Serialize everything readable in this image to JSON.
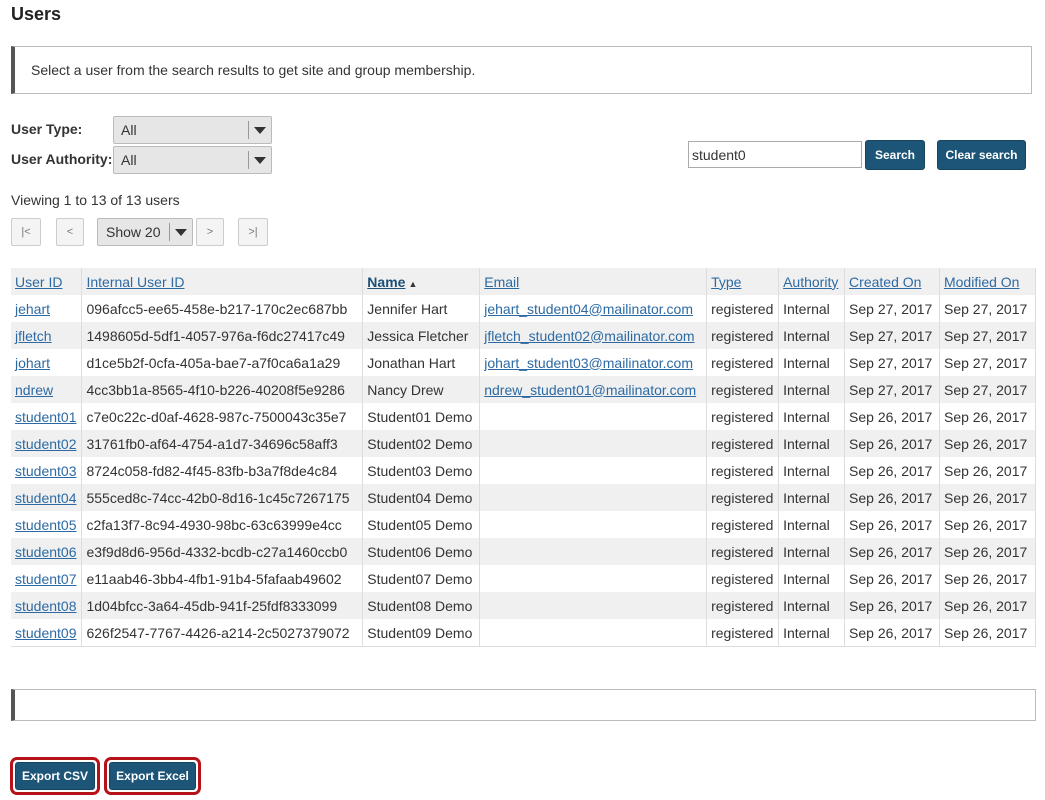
{
  "page": {
    "title": "Users"
  },
  "info": {
    "message": "Select a user from the search results to get site and group membership."
  },
  "filters": {
    "user_type_label": "User Type:",
    "user_type_value": "All",
    "user_authority_label": "User Authority:",
    "user_authority_value": "All"
  },
  "search": {
    "value": "student0",
    "search_label": "Search",
    "clear_label": "Clear search"
  },
  "pager": {
    "viewing_text": "Viewing 1 to 13 of 13 users",
    "first": "|<",
    "prev": "<",
    "show": "Show 20",
    "next": ">",
    "last": ">|"
  },
  "table": {
    "headers": [
      "User ID",
      "Internal User ID",
      "Name",
      "Email",
      "Type",
      "Authority",
      "Created On",
      "Modified On"
    ],
    "sorted_column": "Name",
    "rows": [
      {
        "user_id": "jehart",
        "internal_id": "096afcc5-ee65-458e-b217-170c2ec687bb",
        "name": "Jennifer Hart",
        "email": "jehart_student04@mailinator.com",
        "type": "registered",
        "authority": "Internal",
        "created": "Sep 27, 2017",
        "modified": "Sep 27, 2017"
      },
      {
        "user_id": "jfletch",
        "internal_id": "1498605d-5df1-4057-976a-f6dc27417c49",
        "name": "Jessica Fletcher",
        "email": "jfletch_student02@mailinator.com",
        "type": "registered",
        "authority": "Internal",
        "created": "Sep 27, 2017",
        "modified": "Sep 27, 2017"
      },
      {
        "user_id": "johart",
        "internal_id": "d1ce5b2f-0cfa-405a-bae7-a7f0ca6a1a29",
        "name": "Jonathan Hart",
        "email": "johart_student03@mailinator.com",
        "type": "registered",
        "authority": "Internal",
        "created": "Sep 27, 2017",
        "modified": "Sep 27, 2017"
      },
      {
        "user_id": "ndrew",
        "internal_id": "4cc3bb1a-8565-4f10-b226-40208f5e9286",
        "name": "Nancy Drew",
        "email": "ndrew_student01@mailinator.com",
        "type": "registered",
        "authority": "Internal",
        "created": "Sep 27, 2017",
        "modified": "Sep 27, 2017"
      },
      {
        "user_id": "student01",
        "internal_id": "c7e0c22c-d0af-4628-987c-7500043c35e7",
        "name": "Student01 Demo",
        "email": "",
        "type": "registered",
        "authority": "Internal",
        "created": "Sep 26, 2017",
        "modified": "Sep 26, 2017"
      },
      {
        "user_id": "student02",
        "internal_id": "31761fb0-af64-4754-a1d7-34696c58aff3",
        "name": "Student02 Demo",
        "email": "",
        "type": "registered",
        "authority": "Internal",
        "created": "Sep 26, 2017",
        "modified": "Sep 26, 2017"
      },
      {
        "user_id": "student03",
        "internal_id": "8724c058-fd82-4f45-83fb-b3a7f8de4c84",
        "name": "Student03 Demo",
        "email": "",
        "type": "registered",
        "authority": "Internal",
        "created": "Sep 26, 2017",
        "modified": "Sep 26, 2017"
      },
      {
        "user_id": "student04",
        "internal_id": "555ced8c-74cc-42b0-8d16-1c45c7267175",
        "name": "Student04 Demo",
        "email": "",
        "type": "registered",
        "authority": "Internal",
        "created": "Sep 26, 2017",
        "modified": "Sep 26, 2017"
      },
      {
        "user_id": "student05",
        "internal_id": "c2fa13f7-8c94-4930-98bc-63c63999e4cc",
        "name": "Student05 Demo",
        "email": "",
        "type": "registered",
        "authority": "Internal",
        "created": "Sep 26, 2017",
        "modified": "Sep 26, 2017"
      },
      {
        "user_id": "student06",
        "internal_id": "e3f9d8d6-956d-4332-bcdb-c27a1460ccb0",
        "name": "Student06 Demo",
        "email": "",
        "type": "registered",
        "authority": "Internal",
        "created": "Sep 26, 2017",
        "modified": "Sep 26, 2017"
      },
      {
        "user_id": "student07",
        "internal_id": "e11aab46-3bb4-4fb1-91b4-5fafaab49602",
        "name": "Student07 Demo",
        "email": "",
        "type": "registered",
        "authority": "Internal",
        "created": "Sep 26, 2017",
        "modified": "Sep 26, 2017"
      },
      {
        "user_id": "student08",
        "internal_id": "1d04bfcc-3a64-45db-941f-25fdf8333099",
        "name": "Student08 Demo",
        "email": "",
        "type": "registered",
        "authority": "Internal",
        "created": "Sep 26, 2017",
        "modified": "Sep 26, 2017"
      },
      {
        "user_id": "student09",
        "internal_id": "626f2547-7767-4426-a214-2c5027379072",
        "name": "Student09 Demo",
        "email": "",
        "type": "registered",
        "authority": "Internal",
        "created": "Sep 26, 2017",
        "modified": "Sep 26, 2017"
      }
    ]
  },
  "export": {
    "csv_label": "Export CSV",
    "excel_label": "Export Excel"
  },
  "colors": {
    "primary_button": "#1c5577",
    "link": "#2d6aa3",
    "highlight_border": "#b5121b"
  }
}
